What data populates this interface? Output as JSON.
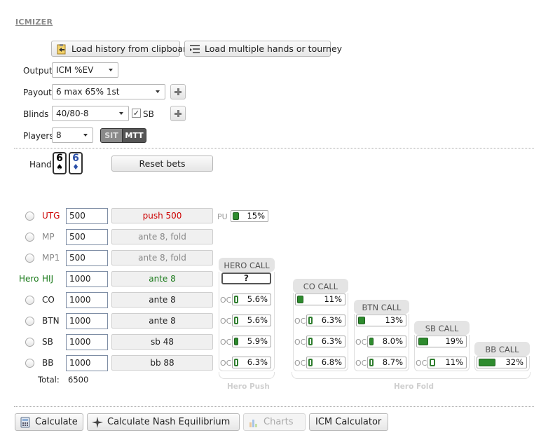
{
  "app": {
    "title": "ICMIZER"
  },
  "top": {
    "load_history": "Load history from clipboard",
    "load_multiple": "Load multiple hands or tourney"
  },
  "settings": {
    "output_label": "Output",
    "output_value": "ICM %EV",
    "payout_label": "Payout",
    "payout_value": "6 max 65% 1st",
    "blinds_label": "Blinds",
    "blinds_value": "40/80-8",
    "sb_checkbox": "SB",
    "sb_checked": true,
    "players_label": "Players",
    "players_value": "8",
    "sit_label": "SIT",
    "mtt_label": "MTT"
  },
  "hand": {
    "label": "Hand",
    "card1_rank": "6",
    "card1_suit": "♠",
    "card2_rank": "6",
    "card2_suit": "♦",
    "reset": "Reset bets"
  },
  "players": [
    {
      "pos": "UTG",
      "stack": "500",
      "action": "push 500",
      "color": "#cc0000"
    },
    {
      "pos": "MP",
      "stack": "500",
      "action": "ante 8, fold",
      "color": "#888888"
    },
    {
      "pos": "MP1",
      "stack": "500",
      "action": "ante 8, fold",
      "color": "#888888"
    },
    {
      "hero": "Hero",
      "pos": "HIJ",
      "stack": "1000",
      "action": "ante 8",
      "color": "#1a7a1a"
    },
    {
      "pos": "CO",
      "stack": "1000",
      "action": "ante 8",
      "color": "#222222"
    },
    {
      "pos": "BTN",
      "stack": "1000",
      "action": "ante 8",
      "color": "#222222"
    },
    {
      "pos": "SB",
      "stack": "1000",
      "action": "sb 48",
      "color": "#222222"
    },
    {
      "pos": "BB",
      "stack": "1000",
      "action": "bb 88",
      "color": "#222222"
    }
  ],
  "total": {
    "label": "Total:",
    "value": "6500"
  },
  "push": {
    "pu_label": "PU",
    "pu_value": "15%"
  },
  "hero_call": {
    "header": "HERO CALL",
    "value": "?",
    "oc": "OC",
    "rows": [
      "5.6%",
      "5.6%",
      "5.9%",
      "6.3%"
    ]
  },
  "co_call": {
    "header": "CO CALL",
    "main": "11%",
    "rows": [
      "6.3%",
      "6.3%",
      "6.8%"
    ]
  },
  "btn_call": {
    "header": "BTN CALL",
    "main": "13%",
    "rows": [
      "8.0%",
      "8.7%"
    ]
  },
  "sb_call": {
    "header": "SB CALL",
    "main": "19%",
    "rows": [
      "11%"
    ]
  },
  "bb_call": {
    "header": "BB CALL",
    "main": "32%"
  },
  "groups": {
    "hero_push": "Hero Push",
    "hero_fold": "Hero Fold"
  },
  "bottom": {
    "calculate": "Calculate",
    "nash": "Calculate Nash Equilibrium",
    "charts": "Charts",
    "icm": "ICM Calculator"
  }
}
